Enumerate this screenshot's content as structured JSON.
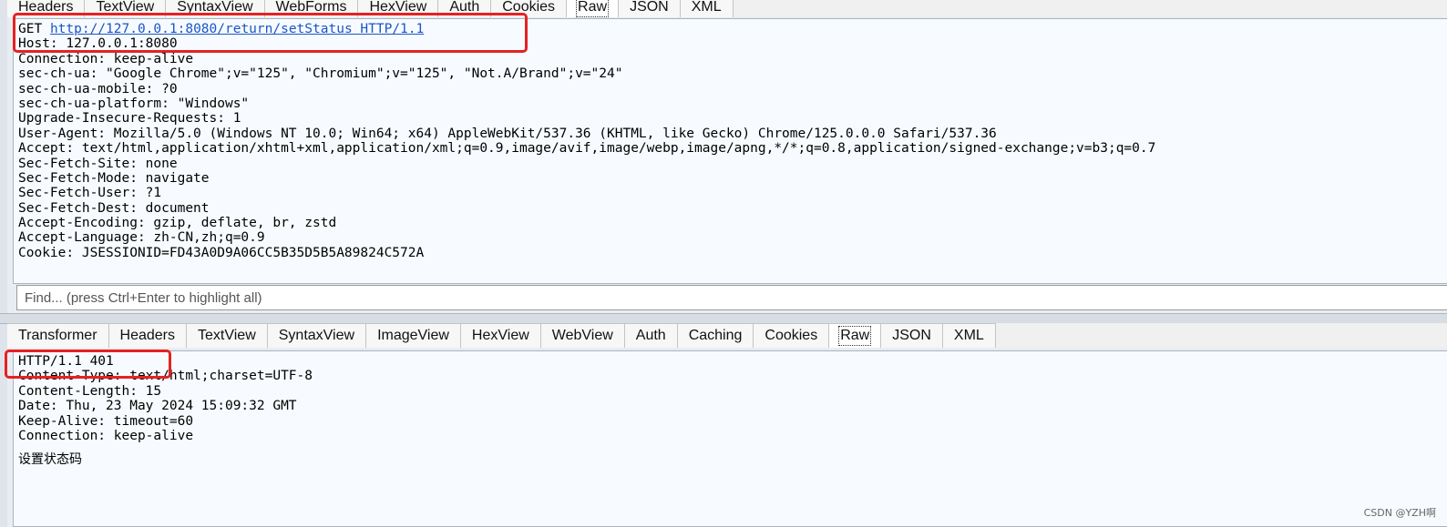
{
  "request": {
    "tabs": [
      "Headers",
      "TextView",
      "SyntaxView",
      "WebForms",
      "HexView",
      "Auth",
      "Cookies",
      "Raw",
      "JSON",
      "XML"
    ],
    "active_tab": "Raw",
    "method": "GET",
    "url_line": "http://127.0.0.1:8080/return/setStatus HTTP/1.1",
    "lines": [
      "Host: 127.0.0.1:8080",
      "Connection: keep-alive",
      "sec-ch-ua: \"Google Chrome\";v=\"125\", \"Chromium\";v=\"125\", \"Not.A/Brand\";v=\"24\"",
      "sec-ch-ua-mobile: ?0",
      "sec-ch-ua-platform: \"Windows\"",
      "Upgrade-Insecure-Requests: 1",
      "User-Agent: Mozilla/5.0 (Windows NT 10.0; Win64; x64) AppleWebKit/537.36 (KHTML, like Gecko) Chrome/125.0.0.0 Safari/537.36",
      "Accept: text/html,application/xhtml+xml,application/xml;q=0.9,image/avif,image/webp,image/apng,*/*;q=0.8,application/signed-exchange;v=b3;q=0.7",
      "Sec-Fetch-Site: none",
      "Sec-Fetch-Mode: navigate",
      "Sec-Fetch-User: ?1",
      "Sec-Fetch-Dest: document",
      "Accept-Encoding: gzip, deflate, br, zstd",
      "Accept-Language: zh-CN,zh;q=0.9",
      "Cookie: JSESSIONID=FD43A0D9A06CC5B35D5B5A89824C572A"
    ]
  },
  "find": {
    "placeholder": "Find... (press Ctrl+Enter to highlight all)"
  },
  "response": {
    "tabs": [
      "Transformer",
      "Headers",
      "TextView",
      "SyntaxView",
      "ImageView",
      "HexView",
      "WebView",
      "Auth",
      "Caching",
      "Cookies",
      "Raw",
      "JSON",
      "XML"
    ],
    "active_tab": "Raw",
    "lines": [
      "HTTP/1.1 401",
      "Content-Type: text/html;charset=UTF-8",
      "Content-Length: 15",
      "Date: Thu, 23 May 2024 15:09:32 GMT",
      "Keep-Alive: timeout=60",
      "Connection: keep-alive"
    ],
    "body": "设置状态码"
  },
  "watermark": "CSDN @YZH啊",
  "colors": {
    "highlight_box": "#e52222",
    "link": "#1a55c6"
  }
}
